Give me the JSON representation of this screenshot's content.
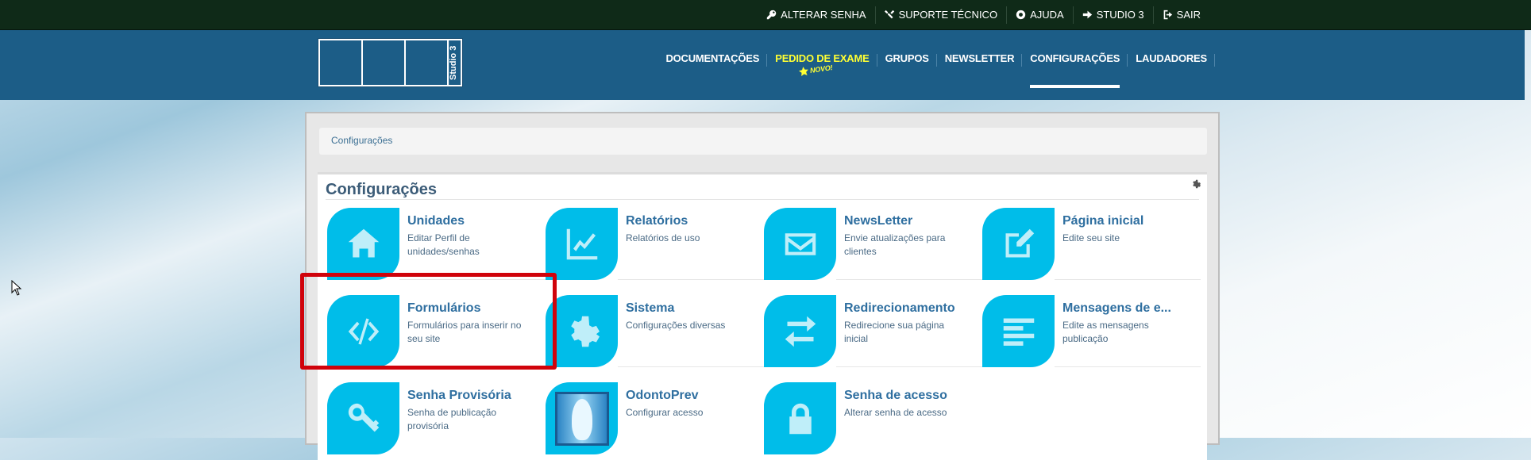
{
  "topbar": {
    "links": [
      {
        "label": "ALTERAR SENHA",
        "icon": "wrench-icon"
      },
      {
        "label": "SUPORTE TÉCNICO",
        "icon": "tools-icon"
      },
      {
        "label": "AJUDA",
        "icon": "lifebuoy-icon"
      },
      {
        "label": "STUDIO 3",
        "icon": "sign-in-icon"
      },
      {
        "label": "SAIR",
        "icon": "sign-out-icon"
      }
    ]
  },
  "header": {
    "logo_text": "Studio 3",
    "nav": [
      {
        "label": "DOCUMENTAÇÕES"
      },
      {
        "label": "PEDIDO DE EXAME",
        "badge": "NOVO!"
      },
      {
        "label": "GRUPOS"
      },
      {
        "label": "NEWSLETTER"
      },
      {
        "label": "CONFIGURAÇÕES",
        "active": true
      },
      {
        "label": "LAUDADORES"
      }
    ]
  },
  "breadcrumb": "Configurações",
  "card": {
    "title": "Configurações",
    "tiles": [
      {
        "title": "Unidades",
        "desc": "Editar Perfil de unidades/senhas",
        "icon": "home-icon"
      },
      {
        "title": "Relatórios",
        "desc": "Relatórios de uso",
        "icon": "line-chart-icon"
      },
      {
        "title": "NewsLetter",
        "desc": "Envie atualizações para clientes",
        "icon": "envelope-icon"
      },
      {
        "title": "Página inicial",
        "desc": "Edite seu site",
        "icon": "edit-icon"
      },
      {
        "title": "Formulários",
        "desc": "Formulários para inserir no seu site",
        "icon": "code-icon"
      },
      {
        "title": "Sistema",
        "desc": "Configurações diversas",
        "icon": "gear-icon"
      },
      {
        "title": "Redirecionamento",
        "desc": "Redirecione sua página inicial",
        "icon": "exchange-icon"
      },
      {
        "title": "Mensagens de e...",
        "desc": "Edite as mensagens publicação",
        "icon": "align-left-icon"
      },
      {
        "title": "Senha Provisória",
        "desc": "Senha de publicação provisória",
        "icon": "key-icon"
      },
      {
        "title": "OdontoPrev",
        "desc": "Configurar acesso",
        "icon": "odontoprev-logo"
      },
      {
        "title": "Senha de acesso",
        "desc": "Alterar senha de acesso",
        "icon": "lock-icon"
      }
    ]
  },
  "colors": {
    "topbar": "#0f2a18",
    "header": "#1c5d87",
    "tile_icon_bg": "#00bde9",
    "tile_title": "#2f6fa0",
    "highlight": "#d0030b",
    "nav_highlight": "#ffff33"
  }
}
